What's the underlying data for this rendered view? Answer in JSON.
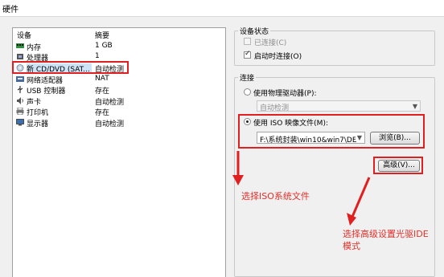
{
  "window": {
    "title": "硬件"
  },
  "device_list": {
    "headers": {
      "device": "设备",
      "summary": "摘要"
    },
    "rows": [
      {
        "icon": "memory-icon",
        "name": "内存",
        "summary": "1 GB"
      },
      {
        "icon": "processor-icon",
        "name": "处理器",
        "summary": "1"
      },
      {
        "icon": "cd-dvd-icon",
        "name": "新 CD/DVD (SAT...",
        "summary": "自动检测",
        "selected": true
      },
      {
        "icon": "network-adapter-icon",
        "name": "网络适配器",
        "summary": "NAT"
      },
      {
        "icon": "usb-icon",
        "name": "USB 控制器",
        "summary": "存在"
      },
      {
        "icon": "sound-card-icon",
        "name": "声卡",
        "summary": "自动检测"
      },
      {
        "icon": "printer-icon",
        "name": "打印机",
        "summary": "存在"
      },
      {
        "icon": "display-icon",
        "name": "显示器",
        "summary": "自动检测"
      }
    ]
  },
  "device_status": {
    "title": "设备状态",
    "connected": {
      "label": "已连接(C)",
      "checked": false,
      "enabled": false
    },
    "connect_at_power_on": {
      "label": "启动时连接(O)",
      "checked": true
    }
  },
  "connection": {
    "title": "连接",
    "physical_drive": {
      "label": "使用物理驱动器(P):",
      "selected": false,
      "dropdown_value": "自动检测"
    },
    "iso_image": {
      "label": "使用 ISO 映像文件(M):",
      "selected": true,
      "path_value": "F:\\系统封装\\win10&win7\\DE"
    },
    "browse_label": "浏览(B)...",
    "advanced_label": "高级(V)..."
  },
  "annotations": {
    "select_iso": "选择ISO系统文件",
    "advanced_line1": "选择高级设置光驱IDE",
    "advanced_line2": "模式"
  },
  "colors": {
    "annotation_red": "#e02020",
    "selection_blue": "#cfe3f7"
  }
}
